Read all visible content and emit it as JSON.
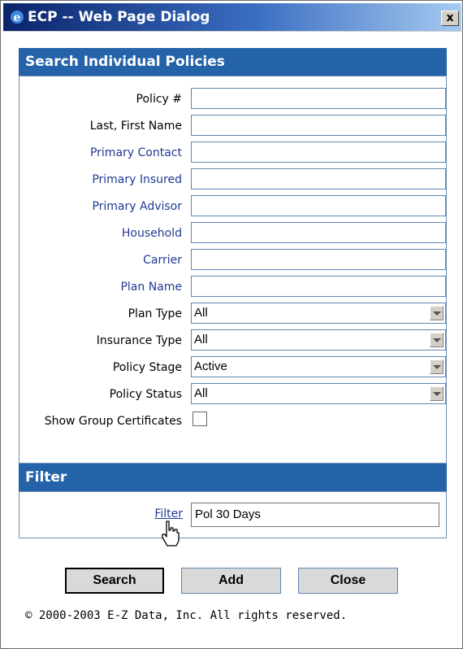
{
  "window": {
    "title": "ECP -- Web Page Dialog",
    "close_label": "x"
  },
  "search_panel": {
    "header": "Search Individual Policies",
    "fields": [
      {
        "label": "Policy #",
        "value": ""
      },
      {
        "label": "Last, First Name",
        "value": ""
      },
      {
        "label": "Primary Contact",
        "value": ""
      },
      {
        "label": "Primary Insured",
        "value": ""
      },
      {
        "label": "Primary Advisor",
        "value": ""
      },
      {
        "label": "Household",
        "value": ""
      },
      {
        "label": "Carrier",
        "value": ""
      },
      {
        "label": "Plan Name",
        "value": ""
      }
    ],
    "selects": [
      {
        "label": "Plan Type",
        "value": "All"
      },
      {
        "label": "Insurance Type",
        "value": "All"
      },
      {
        "label": "Policy Stage",
        "value": "Active"
      },
      {
        "label": "Policy Status",
        "value": "All"
      }
    ],
    "checkbox": {
      "label": "Show Group Certificates",
      "checked": false
    }
  },
  "filter_panel": {
    "header": "Filter",
    "link_label": "Filter",
    "value": "Pol 30 Days"
  },
  "buttons": {
    "search": "Search",
    "add": "Add",
    "close": "Close"
  },
  "footer": {
    "copyright": "© 2000-2003 E-Z Data, Inc. All rights reserved."
  },
  "colors": {
    "header_blue": "#2563a8",
    "title_gradient_start": "#0a246a",
    "link_blue": "#1f3a93"
  }
}
